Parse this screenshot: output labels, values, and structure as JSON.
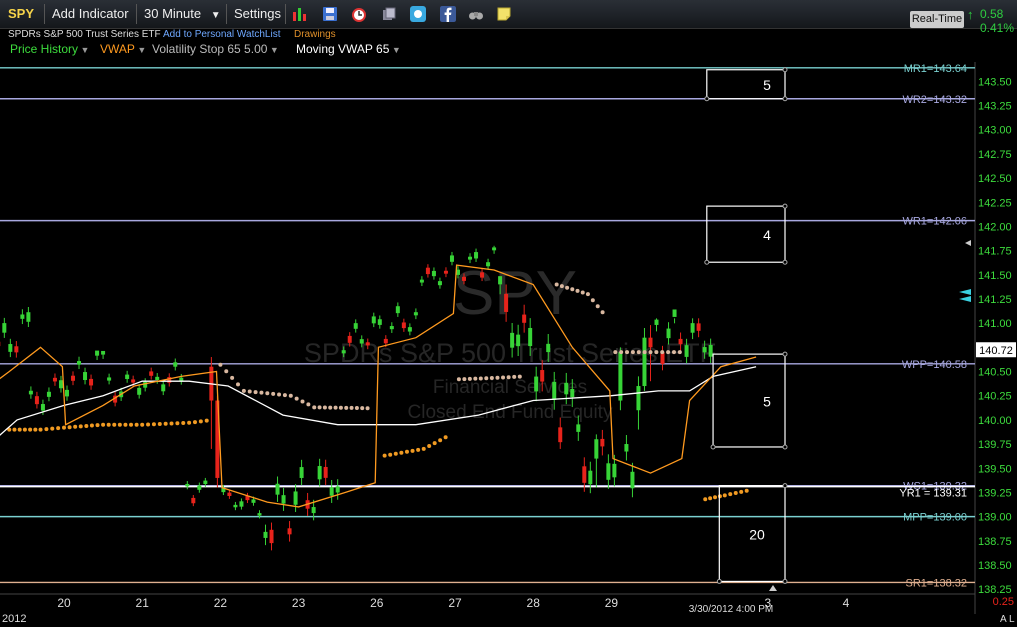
{
  "toolbar": {
    "symbol": "SPY",
    "add_indicator": "Add Indicator",
    "interval": "30 Minute",
    "settings": "Settings",
    "realtime": "Real-Time",
    "change_value": "0.58",
    "change_pct": "0.41%",
    "chevron": "▼"
  },
  "header": {
    "subtitle": "SPDRs S&P 500 Trust Series ETF",
    "watchlist_link": "Add to Personal WatchList",
    "drawings_link": "Drawings"
  },
  "indicators": [
    {
      "label": "Price History",
      "color": "#3ddc3d"
    },
    {
      "label": "VWAP",
      "color": "#ff9a1f"
    },
    {
      "label": "Volatility Stop 65 5.00",
      "color": "#bbbbbb"
    },
    {
      "label": "Moving VWAP 65",
      "color": "#ffffff"
    }
  ],
  "icons": [
    "bar-chart-icon",
    "save-icon",
    "alarm-icon",
    "layers-icon",
    "twitter-icon",
    "facebook-icon",
    "binoculars-icon",
    "note-icon"
  ],
  "chart_data": {
    "type": "candlestick",
    "symbol": "SPY",
    "watermark": "SPY",
    "watermark_line2": "SPDRs S&P 500 Trust Series ETF",
    "watermark_line3": "Financial Services",
    "watermark_line4": "Closed End Fund Equity",
    "ylim": [
      138.2,
      143.7
    ],
    "price_ticks": [
      "143.50",
      "143.25",
      "143.00",
      "142.75",
      "142.50",
      "142.25",
      "142.00",
      "141.75",
      "141.50",
      "141.25",
      "141.00",
      "140.75",
      "140.50",
      "140.25",
      "140.00",
      "139.75",
      "139.50",
      "139.25",
      "139.00",
      "138.75",
      "138.50",
      "138.25"
    ],
    "x_labels": [
      {
        "label": "20",
        "day": 0
      },
      {
        "label": "21",
        "day": 1
      },
      {
        "label": "22",
        "day": 2
      },
      {
        "label": "23",
        "day": 3
      },
      {
        "label": "26",
        "day": 4
      },
      {
        "label": "27",
        "day": 5
      },
      {
        "label": "28",
        "day": 6
      },
      {
        "label": "29",
        "day": 7
      },
      {
        "label": "3",
        "day": 9
      },
      {
        "label": "4",
        "day": 10
      }
    ],
    "year_label": "2012",
    "cursor_label": "3/30/2012 4:00 PM",
    "last_price": "140.72",
    "bottom_value": "0.25",
    "scale_mode": "A",
    "scale_mode2": "L",
    "levels": [
      {
        "label": "MR1=143.64",
        "value": 143.64,
        "color": "#7ad0d0"
      },
      {
        "label": "WR2=143.32",
        "value": 143.32,
        "color": "#a8a8e0"
      },
      {
        "label": "WR1=142.06",
        "value": 142.06,
        "color": "#a8a8e0"
      },
      {
        "label": "WPP=140.58",
        "value": 140.58,
        "color": "#a8a8e0"
      },
      {
        "label": "WS1=139.32",
        "value": 139.32,
        "color": "#a8a8e0"
      },
      {
        "label": "YR1 = 139.31",
        "value": 139.31,
        "color": "#ffffff"
      },
      {
        "label": "MPP=139.00",
        "value": 139.0,
        "color": "#7ad0d0"
      },
      {
        "label": "SR1=138.32",
        "value": 138.32,
        "color": "#e0b090"
      }
    ],
    "boxes": [
      {
        "label": "5",
        "top": 143.62,
        "bottom": 143.32,
        "start": 8.22,
        "end": 9.22
      },
      {
        "label": "4",
        "top": 142.21,
        "bottom": 141.63,
        "start": 8.22,
        "end": 9.22
      },
      {
        "label": "5",
        "top": 140.68,
        "bottom": 139.72,
        "start": 8.3,
        "end": 9.22
      },
      {
        "label": "20",
        "top": 139.32,
        "bottom": 138.33,
        "start": 8.38,
        "end": 9.22
      }
    ],
    "segments": [
      {
        "day": -0.75,
        "open": 140.55,
        "close": 140.95,
        "high": 141.35,
        "low": 140.45,
        "drift": 0.7
      },
      {
        "day": 0.0,
        "open": 140.15,
        "close": 140.6,
        "high": 140.7,
        "low": 139.95,
        "drift": -0.3
      },
      {
        "day": 1.0,
        "open": 140.3,
        "close": 140.45,
        "high": 140.65,
        "low": 140.0,
        "drift": 0.2
      },
      {
        "day": 2.0,
        "open": 139.3,
        "close": 139.1,
        "high": 139.4,
        "low": 138.9,
        "drift": 0.0
      },
      {
        "day": 3.0,
        "open": 138.95,
        "close": 139.4,
        "high": 139.9,
        "low": 138.65,
        "drift": 0.5
      },
      {
        "day": 4.0,
        "open": 140.8,
        "close": 141.05,
        "high": 141.25,
        "low": 140.6,
        "drift": 0.25
      },
      {
        "day": 5.0,
        "open": 141.45,
        "close": 141.65,
        "high": 141.8,
        "low": 141.2,
        "drift": -0.1
      },
      {
        "day": 6.0,
        "open": 141.2,
        "close": 140.0,
        "high": 141.4,
        "low": 139.7,
        "drift": -1.1
      },
      {
        "day": 7.0,
        "open": 139.6,
        "close": 139.55,
        "high": 140.65,
        "low": 139.1,
        "drift": 0.0
      },
      {
        "day": 8.0,
        "open": 140.9,
        "close": 140.8,
        "high": 141.05,
        "low": 139.95,
        "drift": -0.1
      }
    ],
    "candle_overrides": {
      "40": [
        140.55,
        140.2,
        140.65,
        139.7
      ],
      "41": [
        140.2,
        139.4,
        140.25,
        139.3
      ],
      "104": [
        139.6,
        139.8,
        139.85,
        139.3
      ],
      "108": [
        140.2,
        140.7,
        140.75,
        140.1
      ],
      "111": [
        140.1,
        140.35,
        140.45,
        139.9
      ],
      "112": [
        140.35,
        140.85,
        140.95,
        140.3
      ],
      "113": [
        140.85,
        140.75,
        140.98,
        140.4
      ]
    },
    "vwap": [
      [
        -0.95,
        140.35
      ],
      [
        -0.7,
        140.5
      ],
      [
        -0.3,
        140.75
      ],
      [
        -0.02,
        140.55
      ],
      [
        0.02,
        139.95
      ],
      [
        0.5,
        140.15
      ],
      [
        0.9,
        140.35
      ],
      [
        1.5,
        140.45
      ],
      [
        1.95,
        140.5
      ],
      [
        2.02,
        139.3
      ],
      [
        2.6,
        139.15
      ],
      [
        3.0,
        139.1
      ],
      [
        3.6,
        139.25
      ],
      [
        3.98,
        139.35
      ],
      [
        4.02,
        140.75
      ],
      [
        4.5,
        140.85
      ],
      [
        4.98,
        141.1
      ],
      [
        5.02,
        141.6
      ],
      [
        5.5,
        141.55
      ],
      [
        6.0,
        141.4
      ],
      [
        6.5,
        140.75
      ],
      [
        6.98,
        140.3
      ],
      [
        7.02,
        139.6
      ],
      [
        7.5,
        139.45
      ],
      [
        7.9,
        139.6
      ],
      [
        8.0,
        140.2
      ],
      [
        8.4,
        140.55
      ],
      [
        8.85,
        140.65
      ]
    ],
    "moving_vwap": [
      [
        -0.95,
        139.75
      ],
      [
        -0.6,
        140.0
      ],
      [
        0.0,
        140.15
      ],
      [
        0.5,
        140.25
      ],
      [
        1.0,
        140.4
      ],
      [
        1.6,
        140.4
      ],
      [
        2.1,
        140.35
      ],
      [
        2.8,
        140.05
      ],
      [
        3.5,
        139.95
      ],
      [
        4.5,
        139.95
      ],
      [
        5.3,
        140.05
      ],
      [
        6.0,
        140.2
      ],
      [
        7.0,
        140.25
      ],
      [
        7.6,
        140.3
      ],
      [
        8.0,
        140.3
      ],
      [
        8.3,
        140.45
      ],
      [
        8.85,
        140.55
      ]
    ],
    "vstop": [
      [
        -0.95,
        139.5
      ],
      [
        -0.7,
        139.9
      ],
      [
        -0.3,
        139.9
      ],
      [
        0.0,
        139.92
      ],
      [
        0.5,
        139.95
      ],
      [
        1.0,
        139.95
      ],
      [
        1.6,
        139.97
      ],
      [
        1.9,
        140.0
      ],
      [
        2.0,
        140.57
      ],
      [
        2.3,
        140.3
      ],
      [
        2.9,
        140.25
      ],
      [
        3.2,
        140.13
      ],
      [
        3.95,
        140.12
      ],
      [
        4.1,
        139.63
      ],
      [
        4.6,
        139.7
      ],
      [
        4.95,
        139.85
      ],
      [
        5.05,
        140.42
      ],
      [
        5.4,
        140.43
      ],
      [
        5.9,
        140.45
      ],
      [
        6.3,
        141.4
      ],
      [
        6.7,
        141.3
      ],
      [
        6.95,
        141.05
      ],
      [
        7.05,
        140.7
      ],
      [
        7.5,
        140.7
      ],
      [
        7.95,
        140.7
      ],
      [
        8.2,
        139.18
      ],
      [
        8.45,
        139.22
      ],
      [
        8.8,
        139.28
      ]
    ],
    "vstop_colors": {
      "low": "#f09a22",
      "high": "#d9b8a0"
    }
  }
}
